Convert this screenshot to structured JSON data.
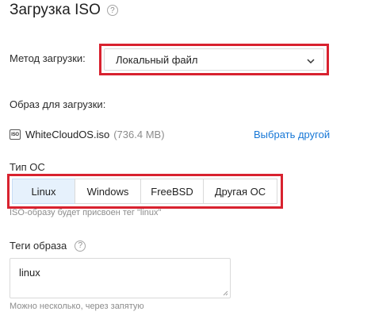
{
  "header": {
    "title": "Загрузка ISO",
    "help_glyph": "?"
  },
  "method": {
    "label": "Метод загрузки:",
    "value": "Локальный файл"
  },
  "image": {
    "label": "Образ для загрузки:",
    "file_name": "WhiteCloudOS.iso",
    "file_size": "(736.4 MB)",
    "icon_text": "ISO",
    "change_link": "Выбрать другой"
  },
  "os_type": {
    "label": "Тип ОС",
    "options": [
      {
        "label": "Linux",
        "active": true
      },
      {
        "label": "Windows",
        "active": false
      },
      {
        "label": "FreeBSD",
        "active": false
      },
      {
        "label": "Другая ОС",
        "active": false
      }
    ],
    "hint": "ISO-образу будет присвоен тег \"linux\""
  },
  "tags": {
    "label": "Теги образа",
    "help_glyph": "?",
    "value": "linux",
    "hint": "Можно несколько, через запятую"
  },
  "colors": {
    "accent": "#1677d6",
    "highlight": "#d8222f",
    "active_segment": "#e6f1fc"
  }
}
